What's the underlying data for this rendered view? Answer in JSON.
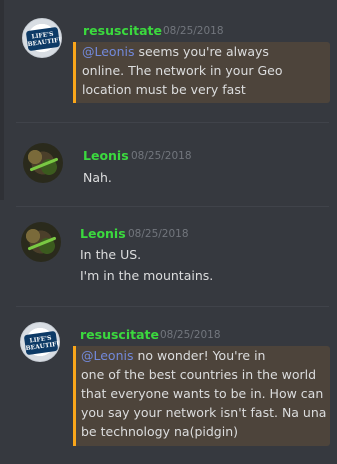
{
  "messages": [
    {
      "author": "resuscitate",
      "timestamp": "08/25/2018",
      "mention": "@Leonis",
      "lines": [
        "seems you're always",
        "online. The network in your Geo",
        "location must be very fast"
      ]
    },
    {
      "author": "Leonis",
      "timestamp": "08/25/2018",
      "lines": [
        "Nah."
      ]
    },
    {
      "author": "Leonis",
      "timestamp": "08/25/2018",
      "lines": [
        "In the US.",
        "I'm in the mountains."
      ]
    },
    {
      "author": "resuscitate",
      "timestamp": "08/25/2018",
      "mention": "@Leonis",
      "lines": [
        "no wonder! You're in",
        "one of the best countries in the world",
        "that everyone wants to be in. How can",
        "you say your network isn't fast. Na una",
        "be technology na(pidgin)"
      ]
    }
  ],
  "avatar_badge_text": "LIFE'S BEAUTIFUL",
  "colors": {
    "background": "#36393f",
    "username": "#3bd93e",
    "mention": "#7289da",
    "mention_highlight_bg": "#4d443b",
    "mention_highlight_bar": "#faa61a",
    "timestamp": "#72767d",
    "text": "#dcddde"
  }
}
